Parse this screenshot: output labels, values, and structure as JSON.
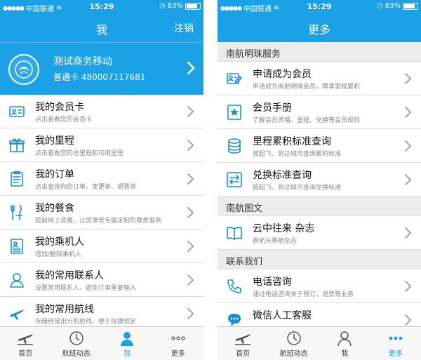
{
  "colors": {
    "primary": "#1aa1e6",
    "icon": "#1a8fd8",
    "background": "#f2f2f2"
  },
  "status_bar": {
    "carrier": "中国联通",
    "time": "15:29",
    "battery": "83%"
  },
  "left_screen": {
    "nav": {
      "title": "我",
      "action": "注销"
    },
    "profile": {
      "name": "测试商务移动",
      "card": "普通卡 480007117681"
    },
    "items": [
      {
        "icon": "member-card-icon",
        "title": "我的会员卡",
        "subtitle": "点击查看您的会员卡"
      },
      {
        "icon": "gift-icon",
        "title": "我的里程",
        "subtitle": "点击查看您的总里程和可用里程"
      },
      {
        "icon": "clipboard-icon",
        "title": "我的订单",
        "subtitle": "点击查询你的订单、变更单、退票单"
      },
      {
        "icon": "utensils-icon",
        "title": "我的餐食",
        "subtitle": "提前网上选餐，让您享受专属定制的尊贵服务"
      },
      {
        "icon": "passenger-list-icon",
        "title": "我的乘机人",
        "subtitle": "增加/删除乘机人"
      },
      {
        "icon": "contact-person-icon",
        "title": "我的常用联系人",
        "subtitle": "设置常用联系人，避免订单重复输入"
      },
      {
        "icon": "airplane-icon",
        "title": "我的常用航线",
        "subtitle": "存储经常出行的航线，便于快捷预定"
      }
    ]
  },
  "right_screen": {
    "nav": {
      "title": "更多"
    },
    "sections": [
      {
        "header": "南航明珠服务",
        "items": [
          {
            "icon": "apply-member-icon",
            "title": "申请成为会员",
            "subtitle": "申请成为南航明珠会员，尊享里程累积"
          },
          {
            "icon": "star-book-icon",
            "title": "会员手册",
            "subtitle": "了解会员资格、里程、兑换等会员规则"
          },
          {
            "icon": "coin-stack-icon",
            "title": "里程累积标准查询",
            "subtitle": "按起飞、到达城市查询累积标准"
          },
          {
            "icon": "exchange-arrows-icon",
            "title": "兑换标准查询",
            "subtitle": "按起飞、到达城市查询兑换标准"
          }
        ]
      },
      {
        "header": "南航图文",
        "items": [
          {
            "icon": "open-book-icon",
            "title": "云中往来 杂志",
            "subtitle": "南航头等舱杂志"
          }
        ]
      },
      {
        "header": "联系我们",
        "items": [
          {
            "icon": "phone-icon",
            "title": "电话咨询",
            "subtitle": "通过电话咨询关于预订、退票等业务"
          },
          {
            "icon": "chat-bubble-icon",
            "title": "微信人工客服",
            "subtitle": ""
          }
        ]
      }
    ]
  },
  "tab_bar": {
    "tabs": [
      {
        "icon": "home-plane-icon",
        "label": "首页"
      },
      {
        "icon": "clock-icon",
        "label": "航班动态"
      },
      {
        "icon": "person-icon",
        "label": "我"
      },
      {
        "icon": "more-dots-icon",
        "label": "更多"
      }
    ],
    "left_active": 2,
    "right_active": 3
  }
}
